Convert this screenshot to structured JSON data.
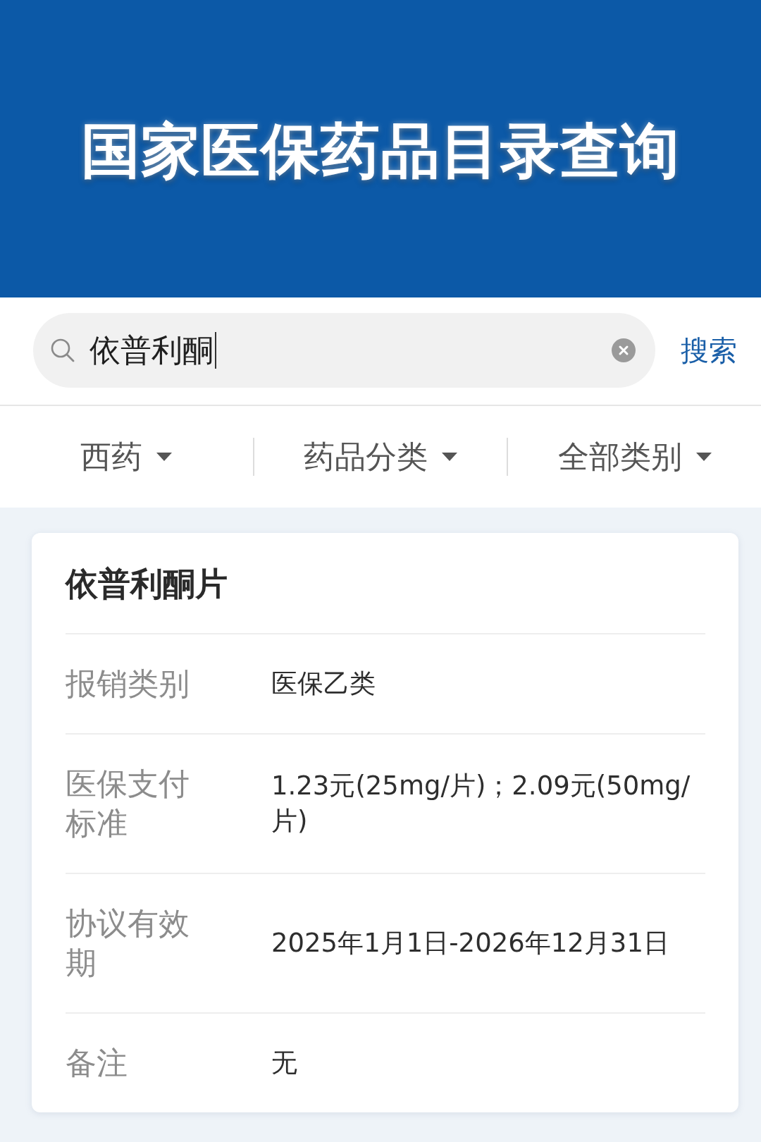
{
  "header": {
    "title": "国家医保药品目录查询"
  },
  "search": {
    "value": "依普利酮",
    "focused": true,
    "button": "搜索"
  },
  "filters": [
    {
      "label": "西药"
    },
    {
      "label": "药品分类"
    },
    {
      "label": "全部类别"
    }
  ],
  "result": {
    "name": "依普利酮片",
    "fields": [
      {
        "label": "报销类别",
        "value": "医保乙类"
      },
      {
        "label": "医保支付标准",
        "value": "1.23元(25mg/片)；2.09元(50mg/片)"
      },
      {
        "label": "协议有效期",
        "value": "2025年1月1日-2026年12月31日"
      },
      {
        "label": "备注",
        "value": "无"
      }
    ]
  }
}
